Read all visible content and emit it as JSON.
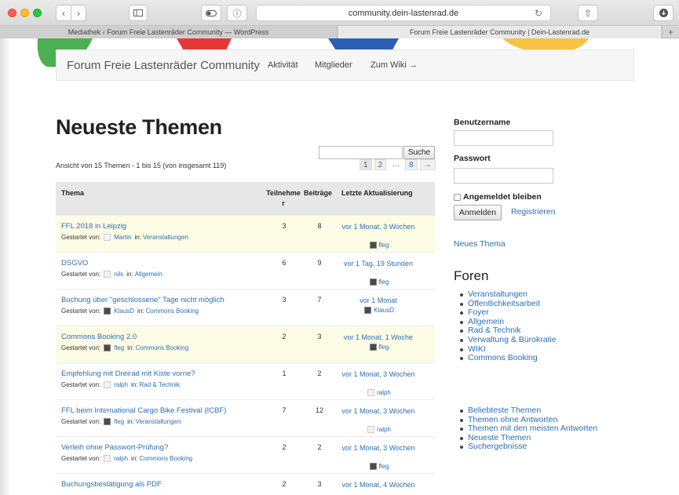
{
  "browser": {
    "url": "community.dein-lastenrad.de",
    "tabs": [
      {
        "label": "Mediathek ‹ Forum Freie Lastenräder Community — WordPress"
      },
      {
        "label": "Forum Freie Lastenräder Community | Dein-Lastenrad.de"
      }
    ],
    "icons": {
      "back": "chevron-left-icon",
      "forward": "chevron-right-icon",
      "sidebar": "sidebar-icon",
      "privacy": "toggle-icon",
      "info": "info-icon",
      "reload": "reload-icon",
      "share": "share-icon",
      "download": "download-icon",
      "new_tab": "plus-icon"
    }
  },
  "site": {
    "title": "Forum Freie Lastenräder Community",
    "nav": [
      "Aktivität",
      "Mitglieder",
      "Zum Wiki →"
    ]
  },
  "main": {
    "heading": "Neueste Themen",
    "search_button": "Suche",
    "search_placeholder": "",
    "count_text": "Ansicht von 15 Themen - 1 bis 15 (von insgesamt 119)",
    "pagination": [
      "1",
      "2",
      "…",
      "8",
      "→"
    ],
    "columns": {
      "topic": "Thema",
      "participants": "Teilnehme\nr",
      "posts": "Beiträge",
      "last_update": "Letzte Aktualisierung"
    },
    "started_by_label": "Gestartet von:",
    "in_label": "in:",
    "topics": [
      {
        "title": "FFL 2018 in Leipzig",
        "author": "Martin",
        "forum": "Veranstaltungen",
        "participants": "3",
        "posts": "8",
        "updated": "vor 1 Monat, 3 Wochen",
        "last_by": "fleg",
        "sticky": true
      },
      {
        "title": "DSGVO",
        "author": "nils",
        "forum": "Allgemein",
        "participants": "6",
        "posts": "9",
        "updated": "vor 1 Tag, 19 Stunden",
        "last_by": "fleg",
        "sticky": false
      },
      {
        "title": "Buchung über \"geschlossene\" Tage nicht möglich",
        "author": "KlausD",
        "forum": "Commons Booking",
        "participants": "3",
        "posts": "7",
        "updated": "vor 1 Monat",
        "last_by": "KlausD",
        "sticky": false
      },
      {
        "title": "Commons Booking 2.0",
        "author": "fleg",
        "forum": "Commons Booking",
        "participants": "2",
        "posts": "3",
        "updated": "vor 1 Monat, 1 Woche",
        "last_by": "fleg",
        "sticky": true
      },
      {
        "title": "Empfehlung mit Dreirad mit Kiste vorne?",
        "author": "ralph",
        "forum": "Rad & Technik",
        "participants": "1",
        "posts": "2",
        "updated": "vor 1 Monat, 3 Wochen",
        "last_by": "ralph",
        "sticky": false
      },
      {
        "title": "FFL beim International Cargo Bike Festival (ICBF)",
        "author": "fleg",
        "forum": "Veranstaltungen",
        "participants": "7",
        "posts": "12",
        "updated": "vor 1 Monat, 3 Wochen",
        "last_by": "ralph",
        "sticky": false
      },
      {
        "title": "Verleih ohne Passwort-Prüfung?",
        "author": "ralph",
        "forum": "Commons Booking",
        "participants": "2",
        "posts": "2",
        "updated": "vor 1 Monat, 3 Wochen",
        "last_by": "fleg",
        "sticky": false
      },
      {
        "title": "Buchungsbestätigung als PDF",
        "author": "",
        "forum": "",
        "participants": "2",
        "posts": "3",
        "updated": "vor 1 Monat, 4 Wochen",
        "last_by": "",
        "sticky": false
      }
    ]
  },
  "sidebar": {
    "username_label": "Benutzername",
    "password_label": "Passwort",
    "remember_label": "Angemeldet bleiben",
    "login_button": "Anmelden",
    "register_link": "Registrieren",
    "new_topic": "Neues Thema",
    "forums_heading": "Foren",
    "forums": [
      "Veranstaltungen",
      "Öffentlichkeitsarbeit",
      "Foyer",
      "Allgemein",
      "Rad & Technik",
      "Verwaltung & Bürokratie",
      "WIKI",
      "Commons Booking"
    ],
    "views": [
      "Beliebteste Themen",
      "Themen ohne Antworten",
      "Themen mit den meisten Antworten",
      "Neueste Themen",
      "Suchergebnisse"
    ]
  },
  "colors": {
    "link": "#2a6fb5",
    "sticky_row": "#fdfde5",
    "deco_green": "#4caf50",
    "deco_red": "#e53935",
    "deco_blue": "#2b5fb5",
    "deco_yellow": "#f6c343"
  }
}
